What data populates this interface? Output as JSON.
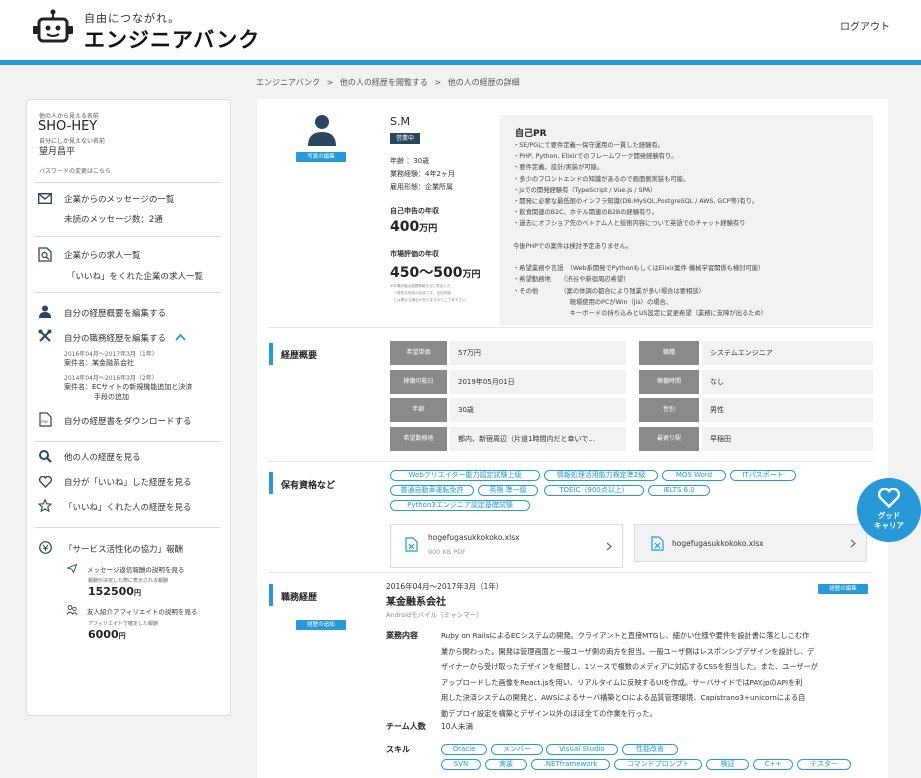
{
  "header": {
    "tagline": "自由につながれ。",
    "logo_name": "エンジニアバンク",
    "logout": "ログアウト"
  },
  "breadcrumb": [
    "エンジニアバンク",
    ">",
    "他の人の経歴を閲覧する",
    ">",
    "他の人の経歴の詳細"
  ],
  "sidebar": {
    "public_name_label": "他の人から見える名前",
    "public_name": "SHO-HEY",
    "private_name_label": "自分にしか見えない名前",
    "private_name": "望月昌平",
    "password_link": "パスワードの変更はこちら",
    "messages_title": "企業からのメッセージの一覧",
    "messages_unread": "未読のメッセージ数：2通",
    "jobs_title": "企業からの求人一覧",
    "jobs_liked": "「いいね」をくれた企業の求人一覧",
    "edit_profile": "自分の経歴概要を編集する",
    "edit_career": "自分の職務経歴を編集する",
    "career1_date": "2016年04月～2017年3月（1年）",
    "career1_name": "案件名：某金融系会社",
    "career2_date": "2014年04月～2016年3月（2年）",
    "career2_name_1": "案件名：ECサイトの新規機能追加と決済",
    "career2_name_2": "手段の追加",
    "download": "自分の経歴書をダウンロードする",
    "view_others": "他の人の経歴を見る",
    "liked_by_me": "自分が「いいね」した経歴を見る",
    "liked_me": "「いいね」くれた人の経歴を見る",
    "service_reward": "「サービス活性化の協力」報酬",
    "reward_msg_link": "メッセージ返信報酬の説明を見る",
    "reward_msg_note": "報酬が決定した際に表示される報酬",
    "reward_msg_amount": "152500",
    "affiliate_link": "友人紹介アフィリエイトの説明を見る",
    "affiliate_note": "アフィリエイトで確定した報酬",
    "affiliate_amount": "6000",
    "currency": "円"
  },
  "profile": {
    "initials": "S.M",
    "status_badge": "営業中",
    "photo_edit": "写真の編集",
    "age": "年齢 ：30歳",
    "experience": "業務経験：4年2ヶ月",
    "employment": "雇用形態：企業所属",
    "self_income_label": "自己申告の年収",
    "self_income_value": "400",
    "income_unit": "万円",
    "market_label": "市場評価の年収",
    "market_value": "450～500",
    "market_note_1": "※市場評価は経歴情報を元に算出した",
    "market_note_2": "　一般的な年収の目安です。当社評価",
    "market_note_3": "　とは異なる場合がありますのでご了承下さい。"
  },
  "self_pr": {
    "title": "自己PR",
    "lines": [
      "・SE/PGにて要件定義～保守運用の一貫した経験有。",
      "・PHP, Python, Elixirでのフレームワーク開発経験有り。",
      "・要件定義、設計/実装が可能。",
      "・多少のフロントエンドの知識があるので画面側実装も可能。",
      "・jsでの開発経験有（TypeScript / Vue.js / SPA）",
      "・開発に必要な最低限のインフラ知識(DB:MySQL,PostgreSQL / AWS, GCP等)有り。",
      "・飲食関連のB2C、ホテル関連のB2Bの経験有り。",
      "・過去にオフショア先のベトナム人と技術内容について英語でのチャット経験有り",
      "",
      "今後PHPでの案件は検討予定ありません。",
      "",
      "・希望業務や言語　（Web系開発でPythonもしくはElixir案件 機械学習関係も検討可能）",
      "・希望勤務地　　（渋谷や新宿周辺希望）",
      "・その他　　　　（案の体調の都合により残業が多い場合は要相談）",
      "　　　　　　　　　現場使用のPCがWin（Jis）の場合、",
      "　　　　　　　　　キーボードの持ち込みとUS設定に変更希望（業務に支障が出るため）"
    ]
  },
  "career_summary": {
    "section_title": "経歴概要",
    "rows": [
      {
        "k1": "希望単価",
        "v1": "57万円",
        "k2": "職種",
        "v2": "システムエンジニア"
      },
      {
        "k1": "稼働可能日",
        "v1": "2019年05月01日",
        "k2": "稼働時間",
        "v2": "なし"
      },
      {
        "k1": "年齢",
        "v1": "30歳",
        "k2": "性別",
        "v2": "男性"
      },
      {
        "k1": "希望勤務地",
        "v1": "都内、新宿周辺（片道1時間内だと幸いで...",
        "k2": "最寄り駅",
        "v2": "早稲田"
      }
    ]
  },
  "qualifications": {
    "section_title": "保有資格など",
    "tags_row1": [
      "Webクリエイター能力認定試験上級",
      "情報処理活用能力検定準2級",
      "MOS Word",
      "ITパスポート"
    ],
    "tags_row2": [
      "普通自動車運転免許",
      "英検 準一級",
      "TOEIC（900点以上）",
      "IELTS 6.0"
    ],
    "tags_row3": [
      "Python3エンジニア認定基礎試験"
    ],
    "file1_name": "hogefugasukkokoko.xlsx",
    "file1_size": "900 KB PDF",
    "file2_name": "hogefugasukkokoko.xlsx"
  },
  "good_button": {
    "label_1": "グッド",
    "label_2": "キャリア"
  },
  "job_history": {
    "section_title": "職務経歴",
    "edit_button": "経歴の追加",
    "item_edit_button": "経歴の編集",
    "date": "2016年04月～2017年3月（1年）",
    "company": "某金融系会社",
    "role": "Androidモバイル（ミャンマー）",
    "duty_label": "業務内容",
    "duty_lines": [
      "Ruby on RailsによるECシステムの開発。クライアントと直接MTGし、細かい仕様や要件を設計書に落としこむ作",
      "業から関わった。開発は管理画面と一般ユーザ側の両方を担当。一般ユーザ側はレスポンシブデザインを設計し、デ",
      "ザイナーから受け取ったデザインを組替し、1ソースで複数のメディアに対応するCSSを担当した。また、ユーザーが",
      "アップロードした画像をReact.jsを用い、リアルタイムに反映するUIを作成。サーバサイドではPAY.jpのAPIを利",
      "用した決済システムの開発と、AWSによるサーバ構築とCIによる品質管理環境、Capistrano3+unicornによる自",
      "動デプロイ設定を構築とデザイン以外のほぼ全ての作業を行った。"
    ],
    "team_label": "チーム人数",
    "team_value": "10人未満",
    "skill_label": "スキル",
    "skills_row1": [
      "Oracle",
      "メンバー",
      "Visual Studio",
      "性能改善"
    ],
    "skills_row2": [
      "SVN",
      "実装",
      ".NETframework",
      "コマンドプロンプト",
      "検証",
      "C++",
      "テスター"
    ]
  },
  "colors": {
    "accent": "#2699d6",
    "header_gray": "#8a8a8a",
    "bg": "#f2f2f2"
  }
}
